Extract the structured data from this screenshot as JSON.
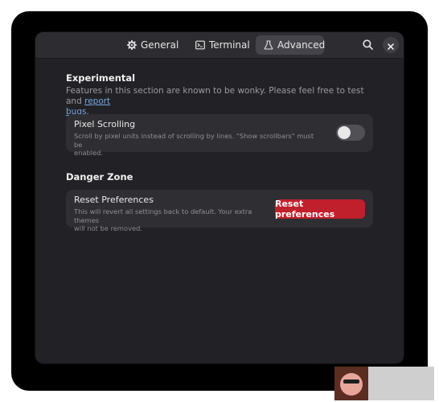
{
  "tabs": [
    {
      "label": "General",
      "icon": "gear-icon",
      "active": false
    },
    {
      "label": "Terminal",
      "icon": "terminal-icon",
      "active": false
    },
    {
      "label": "Advanced",
      "icon": "flask-icon",
      "active": true
    }
  ],
  "header": {
    "search_icon": "search-icon",
    "close_icon": "close-icon"
  },
  "experimental": {
    "title": "Experimental",
    "description": "Features in this section are known to be wonky. Please feel free to test and",
    "link_text_1": "report",
    "link_text_2": "bugs",
    "trailing": ".",
    "pixel_scrolling": {
      "title": "Pixel Scrolling",
      "subtitle_line1": "Scroll by pixel units instead of scrolling by lines. \"Show scrollbars\" must be",
      "subtitle_line2": "enabled.",
      "enabled": false
    }
  },
  "danger_zone": {
    "title": "Danger Zone",
    "reset": {
      "title": "Reset Preferences",
      "subtitle_line1": "This will revert all settings back to default. Your extra themes",
      "subtitle_line2": "will not be removed.",
      "button_label": "Reset preferences"
    }
  },
  "colors": {
    "window_bg": "#222226",
    "card_bg": "#2f2f33",
    "destructive": "#c0202c",
    "link": "#7aa5e0"
  }
}
